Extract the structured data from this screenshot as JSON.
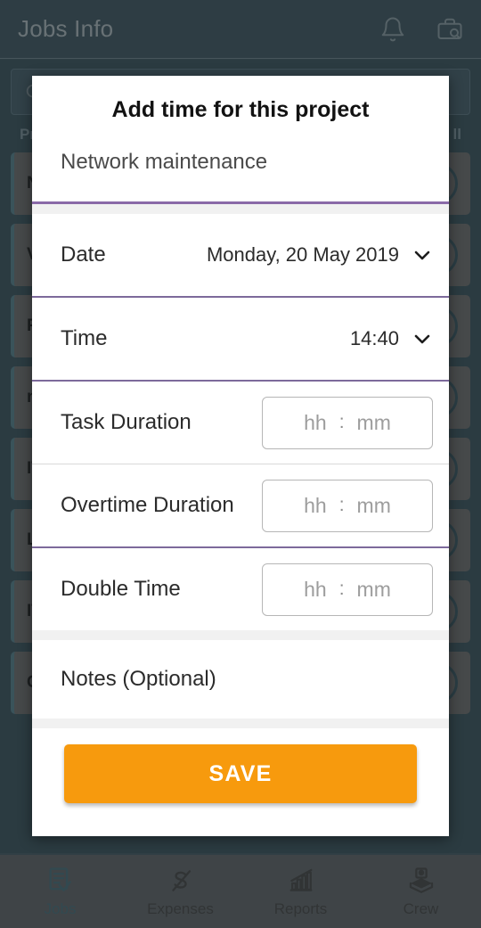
{
  "app": {
    "header": {
      "title": "Jobs Info",
      "icons": [
        {
          "name": "notifications-bell-icon",
          "label": "Notifications"
        },
        {
          "name": "briefcase-search-icon",
          "label": "Search jobs"
        }
      ]
    },
    "background_list": {
      "search_placeholder": "",
      "column_headers": {
        "left": "Pr",
        "right": "ll"
      },
      "items": [
        {
          "label": "Ne"
        },
        {
          "label": "Va"
        },
        {
          "label": "Rid"
        },
        {
          "label": "ne"
        },
        {
          "label": "ITP"
        },
        {
          "label": "Lu"
        },
        {
          "label": "ITP"
        },
        {
          "label": "Ca"
        }
      ]
    },
    "bottom_nav": {
      "items": [
        {
          "label": "Jobs",
          "icon": "document-check-icon",
          "active": true
        },
        {
          "label": "Expenses",
          "icon": "dollar-icon",
          "active": false
        },
        {
          "label": "Reports",
          "icon": "bar-chart-icon",
          "active": false
        },
        {
          "label": "Crew",
          "icon": "crew-stack-icon",
          "active": false
        }
      ]
    }
  },
  "dialog": {
    "title": "Add time for this project",
    "project_name": "Network maintenance",
    "fields": {
      "date": {
        "label": "Date",
        "value": "Monday, 20 May 2019"
      },
      "time": {
        "label": "Time",
        "value": "14:40"
      },
      "task_duration": {
        "label": "Task Duration",
        "hh": "hh",
        "sep": ":",
        "mm": "mm"
      },
      "overtime_duration": {
        "label": "Overtime Duration",
        "hh": "hh",
        "sep": ":",
        "mm": "mm"
      },
      "double_time": {
        "label": "Double Time",
        "hh": "hh",
        "sep": ":",
        "mm": "mm"
      },
      "notes": {
        "label": "Notes (Optional)",
        "value": ""
      }
    },
    "save_button": "SAVE"
  },
  "colors": {
    "header_bg": "#35515d",
    "page_bg": "#2f4c58",
    "accent_purple": "#7d6a9b",
    "save_orange": "#f79a0d",
    "nav_active": "#3e6b79",
    "nav_bg": "#5c6165"
  }
}
